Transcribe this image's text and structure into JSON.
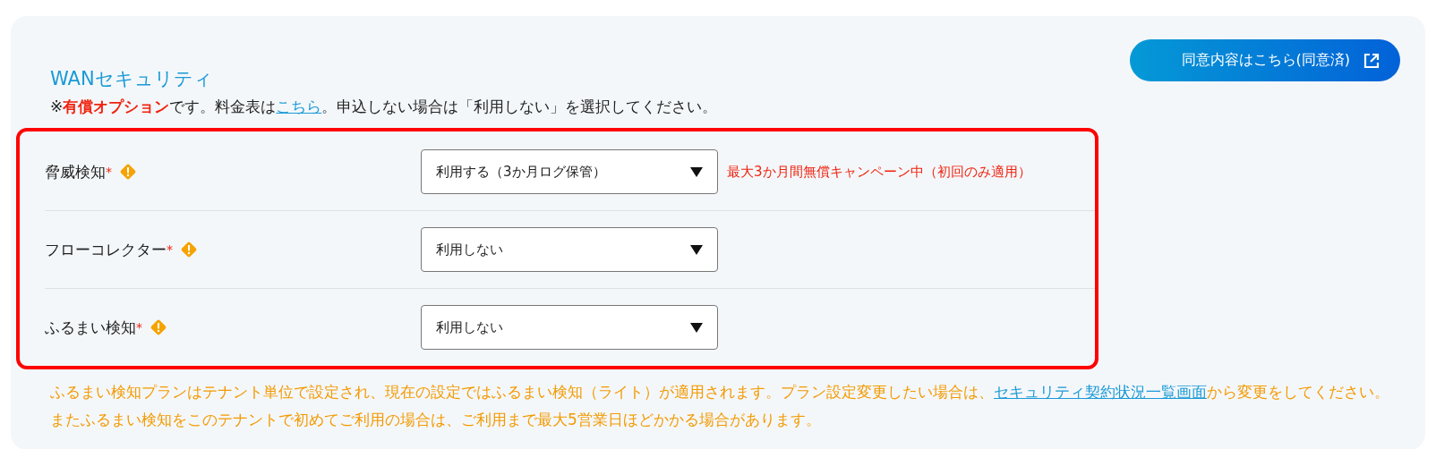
{
  "section": {
    "title": "WANセキュリティ",
    "agreement_button": {
      "label": "同意内容はこちら(同意済)"
    },
    "notice": {
      "before": "※**有償オプション**です。料金表は",
      "link": "こちら",
      "after": "。申込しない場合は「利用しない」を選択してください。"
    },
    "options": {
      "highlighted": true,
      "rows": [
        {
          "label": "脅威検知",
          "required_mark": "*",
          "value": "利用する（3か月ログ保管）",
          "hint": "最大3か月間無償キャンペーン中（初回のみ適用）"
        },
        {
          "label": "フローコレクター",
          "required_mark": "*",
          "value": "利用しない"
        },
        {
          "label": "ふるまい検知",
          "required_mark": "*",
          "value": "利用しない"
        }
      ]
    },
    "footnote": {
      "before": "ふるまい検知プランはテナント単位で設定され、現在の設定ではふるまい検知（ライト）が適用されます。プラン設定変更したい場合は、",
      "link": "セキュリティ契約状況一覧画面",
      "after": "から変更をしてください。またふるまい検知をこのテナントで初めてご利用の場合は、ご利用まで最大5営業日ほどかかる場合があります。"
    }
  }
}
